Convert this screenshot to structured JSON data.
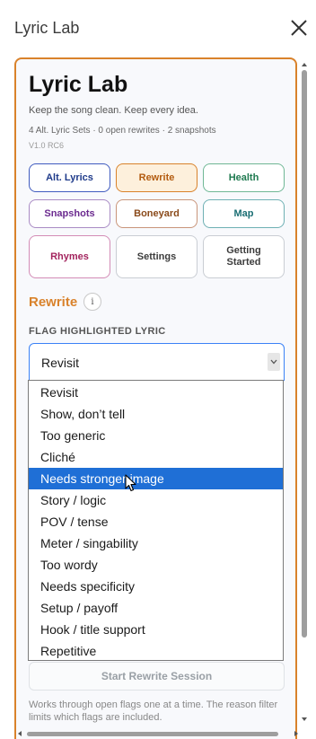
{
  "window": {
    "title": "Lyric Lab",
    "close_icon": "close-icon"
  },
  "panel": {
    "title": "Lyric Lab",
    "tagline": "Keep the song clean. Keep every idea.",
    "stats": "4 Alt. Lyric Sets · 0 open rewrites · 2 snapshots",
    "version": "V1.0 RC6"
  },
  "nav": [
    {
      "label": "Alt. Lyrics",
      "color": "#1e3a8a",
      "border": "#3f5bbf",
      "bg": "#ffffff",
      "active": false
    },
    {
      "label": "Rewrite",
      "color": "#b35c10",
      "border": "#d9822b",
      "bg": "#fdf0dc",
      "active": true
    },
    {
      "label": "Health",
      "color": "#1f7a50",
      "border": "#6fb795",
      "bg": "#ffffff",
      "active": false
    },
    {
      "label": "Snapshots",
      "color": "#6b2a8f",
      "border": "#a98bc4",
      "bg": "#ffffff",
      "active": false
    },
    {
      "label": "Boneyard",
      "color": "#8a4a1a",
      "border": "#c9957a",
      "bg": "#ffffff",
      "active": false
    },
    {
      "label": "Map",
      "color": "#1a6e73",
      "border": "#6fb0b4",
      "bg": "#ffffff",
      "active": false
    },
    {
      "label": "Rhymes",
      "color": "#a3245e",
      "border": "#d38cb6",
      "bg": "#ffffff",
      "active": false
    },
    {
      "label": "Settings",
      "color": "#3c3c3c",
      "border": "#c9cdd3",
      "bg": "#ffffff",
      "active": false
    },
    {
      "label": "Getting Started",
      "color": "#3c3c3c",
      "border": "#c9cdd3",
      "bg": "#ffffff",
      "active": false
    }
  ],
  "section": {
    "title": "Rewrite",
    "info_icon": "info-icon",
    "info_glyph": "i"
  },
  "flag": {
    "label": "FLAG HIGHLIGHTED LYRIC",
    "selected": "Revisit",
    "options": [
      "Revisit",
      "Show, don’t tell",
      "Too generic",
      "Cliché",
      "Needs stronger image",
      "Story / logic",
      "POV / tense",
      "Meter / singability",
      "Too wordy",
      "Needs specificity",
      "Setup / payoff",
      "Hook / title support",
      "Repetitive"
    ],
    "highlighted": "Needs stronger image"
  },
  "start_button": "Start Rewrite Session",
  "help_text": "Works through open flags one at a time. The reason filter limits which flags are included."
}
